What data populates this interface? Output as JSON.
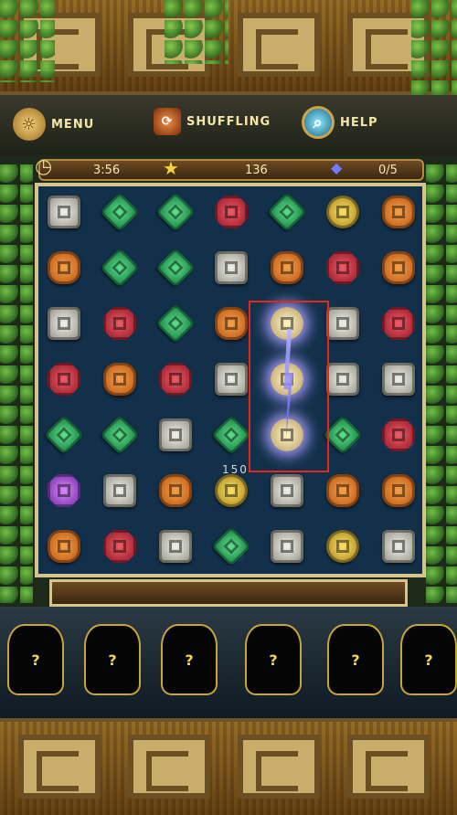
{
  "toolbar": {
    "menu_label": "MENU",
    "shuffle_label": "SHUFFLING",
    "help_label": "HELP"
  },
  "status": {
    "time": "3:56",
    "score": "136",
    "gems": "0/5"
  },
  "board": {
    "rows": [
      [
        "silver",
        "green",
        "green",
        "red",
        "green",
        "yellow",
        "orange"
      ],
      [
        "orange",
        "green",
        "green",
        "silver",
        "orange",
        "red",
        "orange"
      ],
      [
        "silver",
        "red",
        "green",
        "orange",
        "glow",
        "silver",
        "red"
      ],
      [
        "red",
        "orange",
        "red",
        "silver",
        "glow",
        "silver",
        "silver"
      ],
      [
        "green",
        "green",
        "silver",
        "green",
        "glow",
        "green",
        "red"
      ],
      [
        "purple",
        "silver",
        "orange",
        "yellow",
        "silver",
        "orange",
        "orange"
      ],
      [
        "orange",
        "red",
        "silver",
        "green",
        "silver",
        "yellow",
        "silver"
      ]
    ],
    "score_popup": "150"
  },
  "progress": {
    "fraction": 0.0
  },
  "idols": [
    "?",
    "?",
    "?",
    "?",
    "?",
    "?"
  ],
  "colors": {
    "accent": "#e0281e",
    "frame": "#d7c38c"
  }
}
